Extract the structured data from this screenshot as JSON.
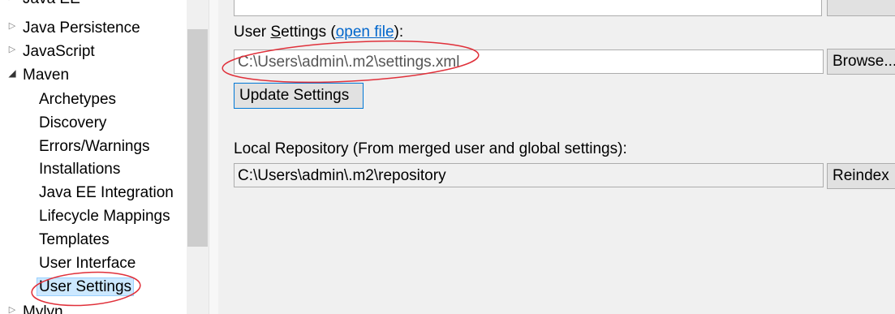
{
  "tree": {
    "items": [
      {
        "label": "Java EE",
        "level": 0,
        "expanded": false
      },
      {
        "label": "Java Persistence",
        "level": 0,
        "expanded": false
      },
      {
        "label": "JavaScript",
        "level": 0,
        "expanded": false
      },
      {
        "label": "Maven",
        "level": 0,
        "expanded": true
      },
      {
        "label": "Archetypes",
        "level": 1
      },
      {
        "label": "Discovery",
        "level": 1
      },
      {
        "label": "Errors/Warnings",
        "level": 1
      },
      {
        "label": "Installations",
        "level": 1
      },
      {
        "label": "Java EE Integration",
        "level": 1
      },
      {
        "label": "Lifecycle Mappings",
        "level": 1
      },
      {
        "label": "Templates",
        "level": 1
      },
      {
        "label": "User Interface",
        "level": 1
      },
      {
        "label": "User Settings",
        "level": 1,
        "selected": true
      },
      {
        "label": "Mylyn",
        "level": 0,
        "expanded": false
      }
    ]
  },
  "user_settings": {
    "label_prefix": "User ",
    "label_mnemonic": "S",
    "label_rest": "ettings (",
    "link_text": "open file",
    "label_suffix": "):",
    "path_value": "C:\\Users\\admin\\.m2\\settings.xml",
    "browse_label": "Browse...",
    "update_label": "Update Settings"
  },
  "local_repository": {
    "label": "Local Repository (From merged user and global settings):",
    "path_value": "C:\\Users\\admin\\.m2\\repository",
    "reindex_label": "Reindex"
  },
  "colors": {
    "annotation": "#e0303a",
    "selection_bg": "#cce8ff",
    "link": "#0066cc"
  }
}
